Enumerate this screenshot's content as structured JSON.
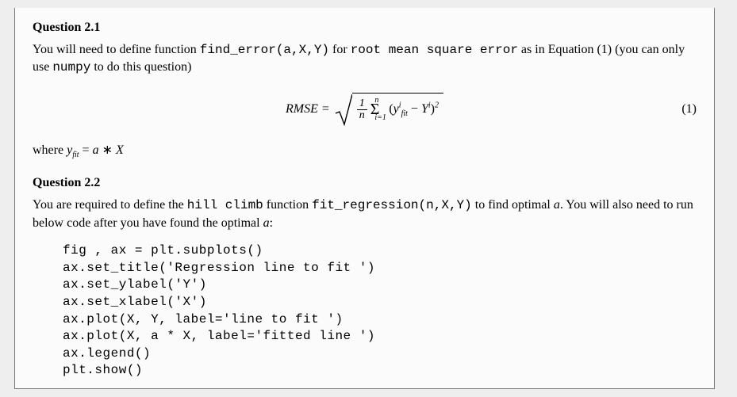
{
  "q1": {
    "title": "Question 2.1",
    "text_1": "You will need to define function ",
    "fn": "find_error(a,X,Y)",
    "text_2": " for ",
    "rmse_label": "root mean square error",
    "text_3": " as in Equation (1) (you can only use ",
    "numpy": "numpy",
    "text_4": " to do this question)",
    "eq_label": "RMSE =",
    "eq_num": "(1)",
    "frac_num": "1",
    "frac_den": "n",
    "sigma": "Σ",
    "sigma_top": "n",
    "sigma_bot": "i=1",
    "term_open": "(",
    "term_y": "y",
    "term_y_sup": "i",
    "term_y_sub": "fit",
    "term_minus": " − ",
    "term_Y": "Y",
    "term_Y_sup": "i",
    "term_close": ")",
    "term_sq": "2",
    "where_1": "where ",
    "where_y": "y",
    "where_sub": "fit",
    "where_eq": " = ",
    "where_a": "a",
    "where_ast": " ∗ ",
    "where_X": "X"
  },
  "q2": {
    "title": "Question 2.2",
    "text_1": "You are required to define the ",
    "hill": "hill climb",
    "text_2": " function ",
    "fn": "fit_regression(n,X,Y)",
    "text_3": " to find optimal ",
    "a": "a",
    "text_4": ". You will also need to run below code after you have found the optimal ",
    "a2": "a",
    "text_5": ":",
    "code": "fig , ax = plt.subplots()\nax.set_title('Regression line to fit ')\nax.set_ylabel('Y')\nax.set_xlabel('X')\nax.plot(X, Y, label='line to fit ')\nax.plot(X, a * X, label='fitted line ')\nax.legend()\nplt.show()"
  }
}
